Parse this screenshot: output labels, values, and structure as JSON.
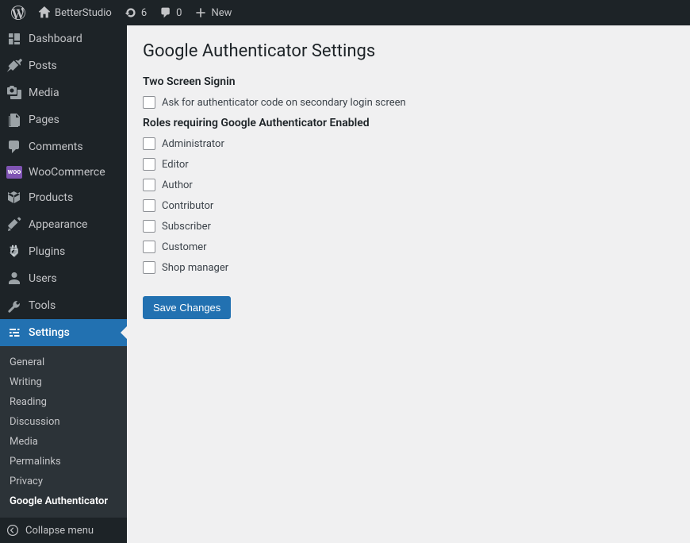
{
  "topbar": {
    "site_name": "BetterStudio",
    "refresh_count": "6",
    "comment_count": "0",
    "new_label": "New"
  },
  "sidebar": {
    "items": [
      {
        "label": "Dashboard"
      },
      {
        "label": "Posts"
      },
      {
        "label": "Media"
      },
      {
        "label": "Pages"
      },
      {
        "label": "Comments"
      },
      {
        "label": "WooCommerce"
      },
      {
        "label": "Products"
      },
      {
        "label": "Appearance"
      },
      {
        "label": "Plugins"
      },
      {
        "label": "Users"
      },
      {
        "label": "Tools"
      },
      {
        "label": "Settings"
      }
    ],
    "submenu": [
      {
        "label": "General"
      },
      {
        "label": "Writing"
      },
      {
        "label": "Reading"
      },
      {
        "label": "Discussion"
      },
      {
        "label": "Media"
      },
      {
        "label": "Permalinks"
      },
      {
        "label": "Privacy"
      },
      {
        "label": "Google Authenticator"
      }
    ],
    "collapse_label": "Collapse menu"
  },
  "page": {
    "title": "Google Authenticator Settings",
    "section1_heading": "Two Screen Signin",
    "ask_code_label": "Ask for authenticator code on secondary login screen",
    "section2_heading": "Roles requiring Google Authenticator Enabled",
    "roles": [
      "Administrator",
      "Editor",
      "Author",
      "Contributor",
      "Subscriber",
      "Customer",
      "Shop manager"
    ],
    "save_label": "Save Changes"
  }
}
